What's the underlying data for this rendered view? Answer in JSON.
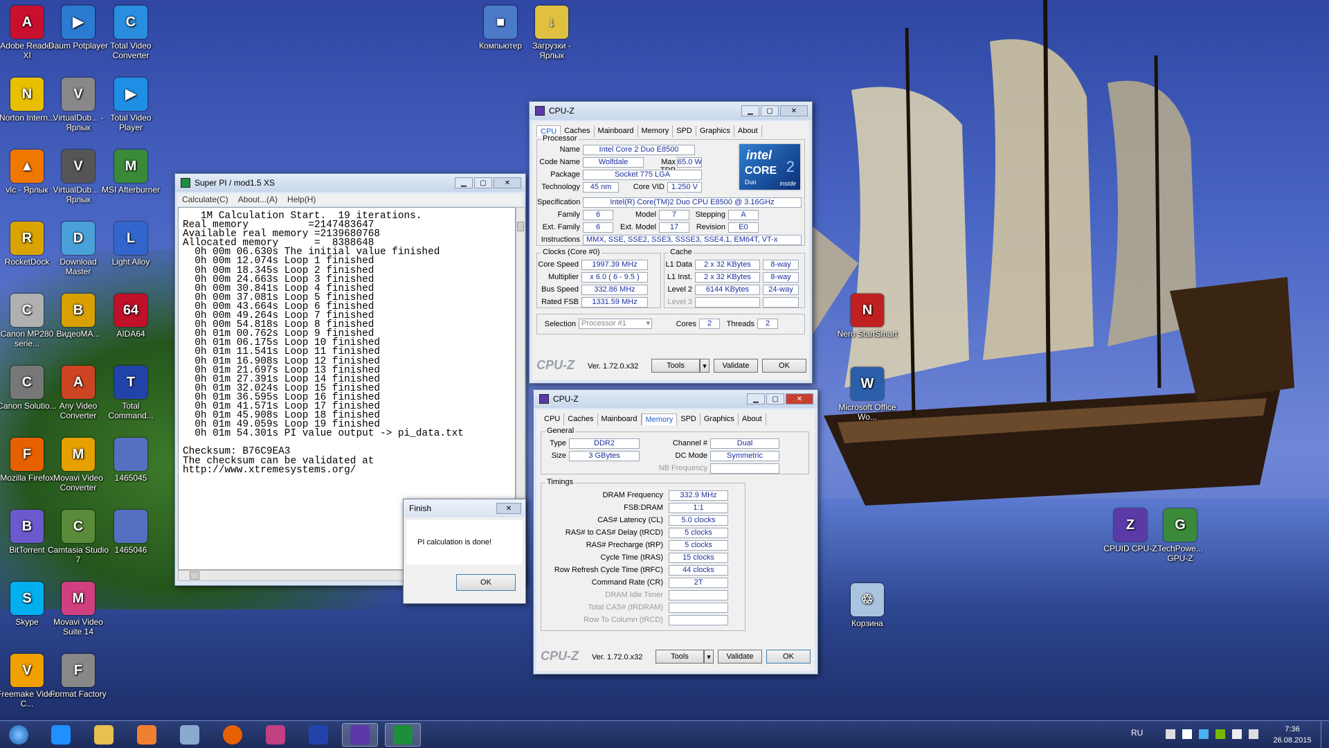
{
  "desktop": {
    "icons": [
      {
        "label": "Adobe Reader XI",
        "color": "#c8102e",
        "glyph": "A"
      },
      {
        "label": "Daum Potplayer",
        "color": "#2b7bd3",
        "glyph": "▶"
      },
      {
        "label": "Total Video Converter",
        "color": "#2a8ee0",
        "glyph": "C"
      },
      {
        "label": "Norton Intern...",
        "color": "#e8c000",
        "glyph": "N"
      },
      {
        "label": "VirtualDub... - Ярлык",
        "color": "#888888",
        "glyph": "V"
      },
      {
        "label": "Total Video Player",
        "color": "#1f8fe5",
        "glyph": "▶"
      },
      {
        "label": "vlc - Ярлык",
        "color": "#f07800",
        "glyph": "▲"
      },
      {
        "label": "VirtualDub... - Ярлык",
        "color": "#555555",
        "glyph": "V"
      },
      {
        "label": "MSI Afterburner",
        "color": "#3a8a3a",
        "glyph": "M"
      },
      {
        "label": "RocketDock",
        "color": "#d9a400",
        "glyph": "R"
      },
      {
        "label": "Download Master",
        "color": "#4aa0d8",
        "glyph": "D"
      },
      {
        "label": "Light Alloy",
        "color": "#3366cc",
        "glyph": "L"
      },
      {
        "label": "Canon MP280 serie...",
        "color": "#b0b0b0",
        "glyph": "C"
      },
      {
        "label": "ВидеоМА...",
        "color": "#d8a000",
        "glyph": "B"
      },
      {
        "label": "AIDA64",
        "color": "#c0102a",
        "glyph": "64"
      },
      {
        "label": "Canon Solutio...",
        "color": "#777777",
        "glyph": "C"
      },
      {
        "label": "Any Video Converter",
        "color": "#cc4422",
        "glyph": "A"
      },
      {
        "label": "Total Command...",
        "color": "#2244aa",
        "glyph": "T"
      },
      {
        "label": "Mozilla Firefox",
        "color": "#e66000",
        "glyph": "F"
      },
      {
        "label": "Movavi Video Converter",
        "color": "#e6a000",
        "glyph": "M"
      },
      {
        "label": "1465045",
        "color": "#5570c0",
        "glyph": ""
      },
      {
        "label": "BitTorrent",
        "color": "#6a5acd",
        "glyph": "B"
      },
      {
        "label": "Camtasia Studio 7",
        "color": "#5a8a3a",
        "glyph": "C"
      },
      {
        "label": "1465046",
        "color": "#5570c0",
        "glyph": ""
      },
      {
        "label": "Skype",
        "color": "#00aff0",
        "glyph": "S"
      },
      {
        "label": "Movavi Video Suite 14",
        "color": "#d04080",
        "glyph": "M"
      },
      {
        "label": "Freemake Video C...",
        "color": "#f0a000",
        "glyph": "V"
      },
      {
        "label": "Format Factory",
        "color": "#888888",
        "glyph": "F"
      },
      {
        "label": "Компьютер",
        "color": "#4a7ac8",
        "glyph": "■"
      },
      {
        "label": "Загрузки - Ярлык",
        "color": "#e0c040",
        "glyph": "↓"
      },
      {
        "label": "Nero StartSmart",
        "color": "#c02020",
        "glyph": "N"
      },
      {
        "label": "Microsoft Office Wo...",
        "color": "#2b5faa",
        "glyph": "W"
      },
      {
        "label": "CPUID CPU-Z",
        "color": "#5b3aa8",
        "glyph": "Z"
      },
      {
        "label": "TechPowe... GPU-Z",
        "color": "#3a8a3a",
        "glyph": "G"
      },
      {
        "label": "Корзина",
        "color": "#aac4e0",
        "glyph": "♲"
      }
    ]
  },
  "superpi": {
    "title": "Super PI / mod1.5 XS",
    "menu": [
      "Calculate(C)",
      "About...(A)",
      "Help(H)"
    ],
    "lines": [
      "   1M Calculation Start.  19 iterations.",
      "Real memory          =2147483647",
      "Available real memory =2139680768",
      "Allocated memory      =  8388648",
      "  0h 00m 06.630s The initial value finished",
      "  0h 00m 12.074s Loop 1 finished",
      "  0h 00m 18.345s Loop 2 finished",
      "  0h 00m 24.663s Loop 3 finished",
      "  0h 00m 30.841s Loop 4 finished",
      "  0h 00m 37.081s Loop 5 finished",
      "  0h 00m 43.664s Loop 6 finished",
      "  0h 00m 49.264s Loop 7 finished",
      "  0h 00m 54.818s Loop 8 finished",
      "  0h 01m 00.762s Loop 9 finished",
      "  0h 01m 06.175s Loop 10 finished",
      "  0h 01m 11.541s Loop 11 finished",
      "  0h 01m 16.908s Loop 12 finished",
      "  0h 01m 21.697s Loop 13 finished",
      "  0h 01m 27.391s Loop 14 finished",
      "  0h 01m 32.024s Loop 15 finished",
      "  0h 01m 36.595s Loop 16 finished",
      "  0h 01m 41.571s Loop 17 finished",
      "  0h 01m 45.908s Loop 18 finished",
      "  0h 01m 49.059s Loop 19 finished",
      "  0h 01m 54.301s PI value output -> pi_data.txt",
      "",
      "Checksum: B76C9EA3",
      "The checksum can be validated at",
      "http://www.xtremesystems.org/"
    ]
  },
  "finish": {
    "title": "Finish",
    "message": "PI calculation is done!",
    "ok": "OK"
  },
  "cpuz1": {
    "title": "CPU-Z",
    "tabs": [
      "CPU",
      "Caches",
      "Mainboard",
      "Memory",
      "SPD",
      "Graphics",
      "About"
    ],
    "processor_legend": "Processor",
    "name_l": "Name",
    "name": "Intel Core 2 Duo E8500",
    "code_l": "Code Name",
    "code": "Wolfdale",
    "tdp_l": "Max TDP",
    "tdp": "65.0 W",
    "pkg_l": "Package",
    "pkg": "Socket 775 LGA",
    "tech_l": "Technology",
    "tech": "45 nm",
    "vid_l": "Core VID",
    "vid": "1.250 V",
    "spec_l": "Specification",
    "spec": "Intel(R) Core(TM)2 Duo CPU     E8500  @ 3.16GHz",
    "fam_l": "Family",
    "fam": "6",
    "mod_l": "Model",
    "mod": "7",
    "step_l": "Stepping",
    "step": "A",
    "efam_l": "Ext. Family",
    "efam": "6",
    "emod_l": "Ext. Model",
    "emod": "17",
    "rev_l": "Revision",
    "rev": "E0",
    "ins_l": "Instructions",
    "ins": "MMX, SSE, SSE2, SSE3, SSSE3, SSE4.1, EM64T, VT-x",
    "clocks_legend": "Clocks (Core #0)",
    "cs_l": "Core Speed",
    "cs": "1997.39 MHz",
    "mult_l": "Multiplier",
    "mult": "x 6.0 ( 6 - 9.5 )",
    "bus_l": "Bus Speed",
    "bus": "332.86 MHz",
    "fsb_l": "Rated FSB",
    "fsb": "1331.59 MHz",
    "cache_legend": "Cache",
    "l1d_l": "L1 Data",
    "l1d": "2 x 32 KBytes",
    "l1d_w": "8-way",
    "l1i_l": "L1 Inst.",
    "l1i": "2 x 32 KBytes",
    "l1i_w": "8-way",
    "l2_l": "Level 2",
    "l2": "6144 KBytes",
    "l2_w": "24-way",
    "l3_l": "Level 3",
    "sel_l": "Selection",
    "sel": "Processor #1",
    "cores_l": "Cores",
    "cores": "2",
    "thr_l": "Threads",
    "thr": "2",
    "logo": "CPU-Z",
    "ver": "Ver. 1.72.0.x32",
    "tools": "Tools",
    "validate": "Validate",
    "ok": "OK",
    "intel": "intel",
    "core": "CORE",
    "duo": "Duo",
    "inside": "inside"
  },
  "cpuz2": {
    "title": "CPU-Z",
    "tabs": [
      "CPU",
      "Caches",
      "Mainboard",
      "Memory",
      "SPD",
      "Graphics",
      "About"
    ],
    "general_legend": "General",
    "type_l": "Type",
    "type": "DDR2",
    "ch_l": "Channel #",
    "ch": "Dual",
    "size_l": "Size",
    "size": "3 GBytes",
    "dc_l": "DC Mode",
    "dc": "Symmetric",
    "nb_l": "NB Frequency",
    "timings_legend": "Timings",
    "timings": [
      {
        "l": "DRAM Frequency",
        "v": "332.9 MHz",
        "dis": false
      },
      {
        "l": "FSB:DRAM",
        "v": "1:1",
        "dis": false
      },
      {
        "l": "CAS# Latency (CL)",
        "v": "5.0 clocks",
        "dis": false
      },
      {
        "l": "RAS# to CAS# Delay (tRCD)",
        "v": "5 clocks",
        "dis": false
      },
      {
        "l": "RAS# Precharge (tRP)",
        "v": "5 clocks",
        "dis": false
      },
      {
        "l": "Cycle Time (tRAS)",
        "v": "15 clocks",
        "dis": false
      },
      {
        "l": "Row Refresh Cycle Time (tRFC)",
        "v": "44 clocks",
        "dis": false
      },
      {
        "l": "Command Rate (CR)",
        "v": "2T",
        "dis": false
      },
      {
        "l": "DRAM Idle Timer",
        "v": "",
        "dis": true
      },
      {
        "l": "Total CAS# (tRDRAM)",
        "v": "",
        "dis": true
      },
      {
        "l": "Row To Column (tRCD)",
        "v": "",
        "dis": true
      }
    ],
    "logo": "CPU-Z",
    "ver": "Ver. 1.72.0.x32",
    "tools": "Tools",
    "validate": "Validate",
    "ok": "OK"
  },
  "taskbar": {
    "lang": "RU",
    "time": "7:36",
    "date": "26.08.2015"
  }
}
